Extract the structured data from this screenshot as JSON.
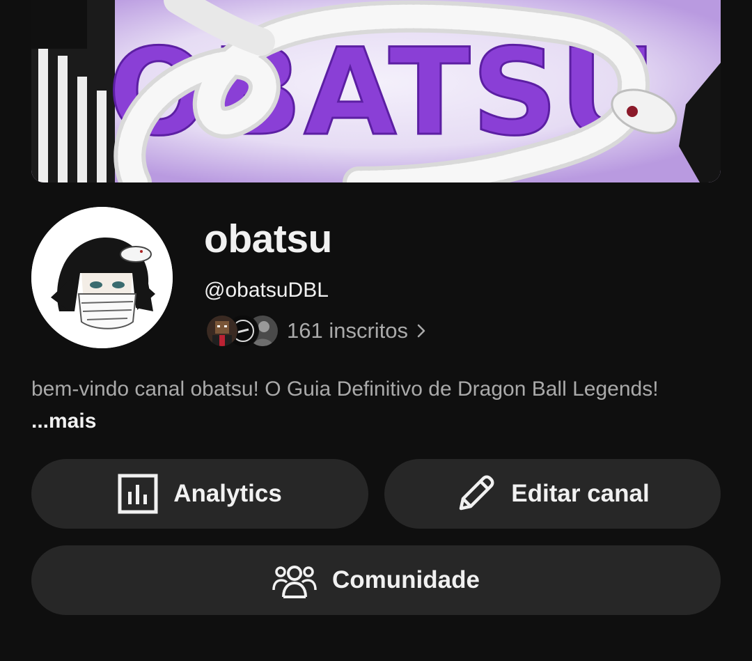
{
  "banner": {
    "art_text": "OBATSU",
    "accent_color": "#8a3fd6"
  },
  "channel": {
    "name": "obatsu",
    "handle": "@obatsuDBL",
    "subscribers": "161 inscritos",
    "description": "bem-vindo canal obatsu! O Guia Definitivo de Dragon Ball Legends!",
    "more_label": "...mais"
  },
  "subscriber_avatars": [
    "minecraft-style-avatar",
    "dark-logo-avatar",
    "photo-avatar"
  ],
  "actions": {
    "analytics_label": "Analytics",
    "analytics_icon": "analytics-chart-icon",
    "edit_label": "Editar canal",
    "edit_icon": "pencil-icon",
    "community_label": "Comunidade",
    "community_icon": "people-group-icon"
  },
  "colors": {
    "background": "#0f0f0f",
    "button": "#272727",
    "text_primary": "#f1f1f1",
    "text_secondary": "#aaaaaa"
  }
}
